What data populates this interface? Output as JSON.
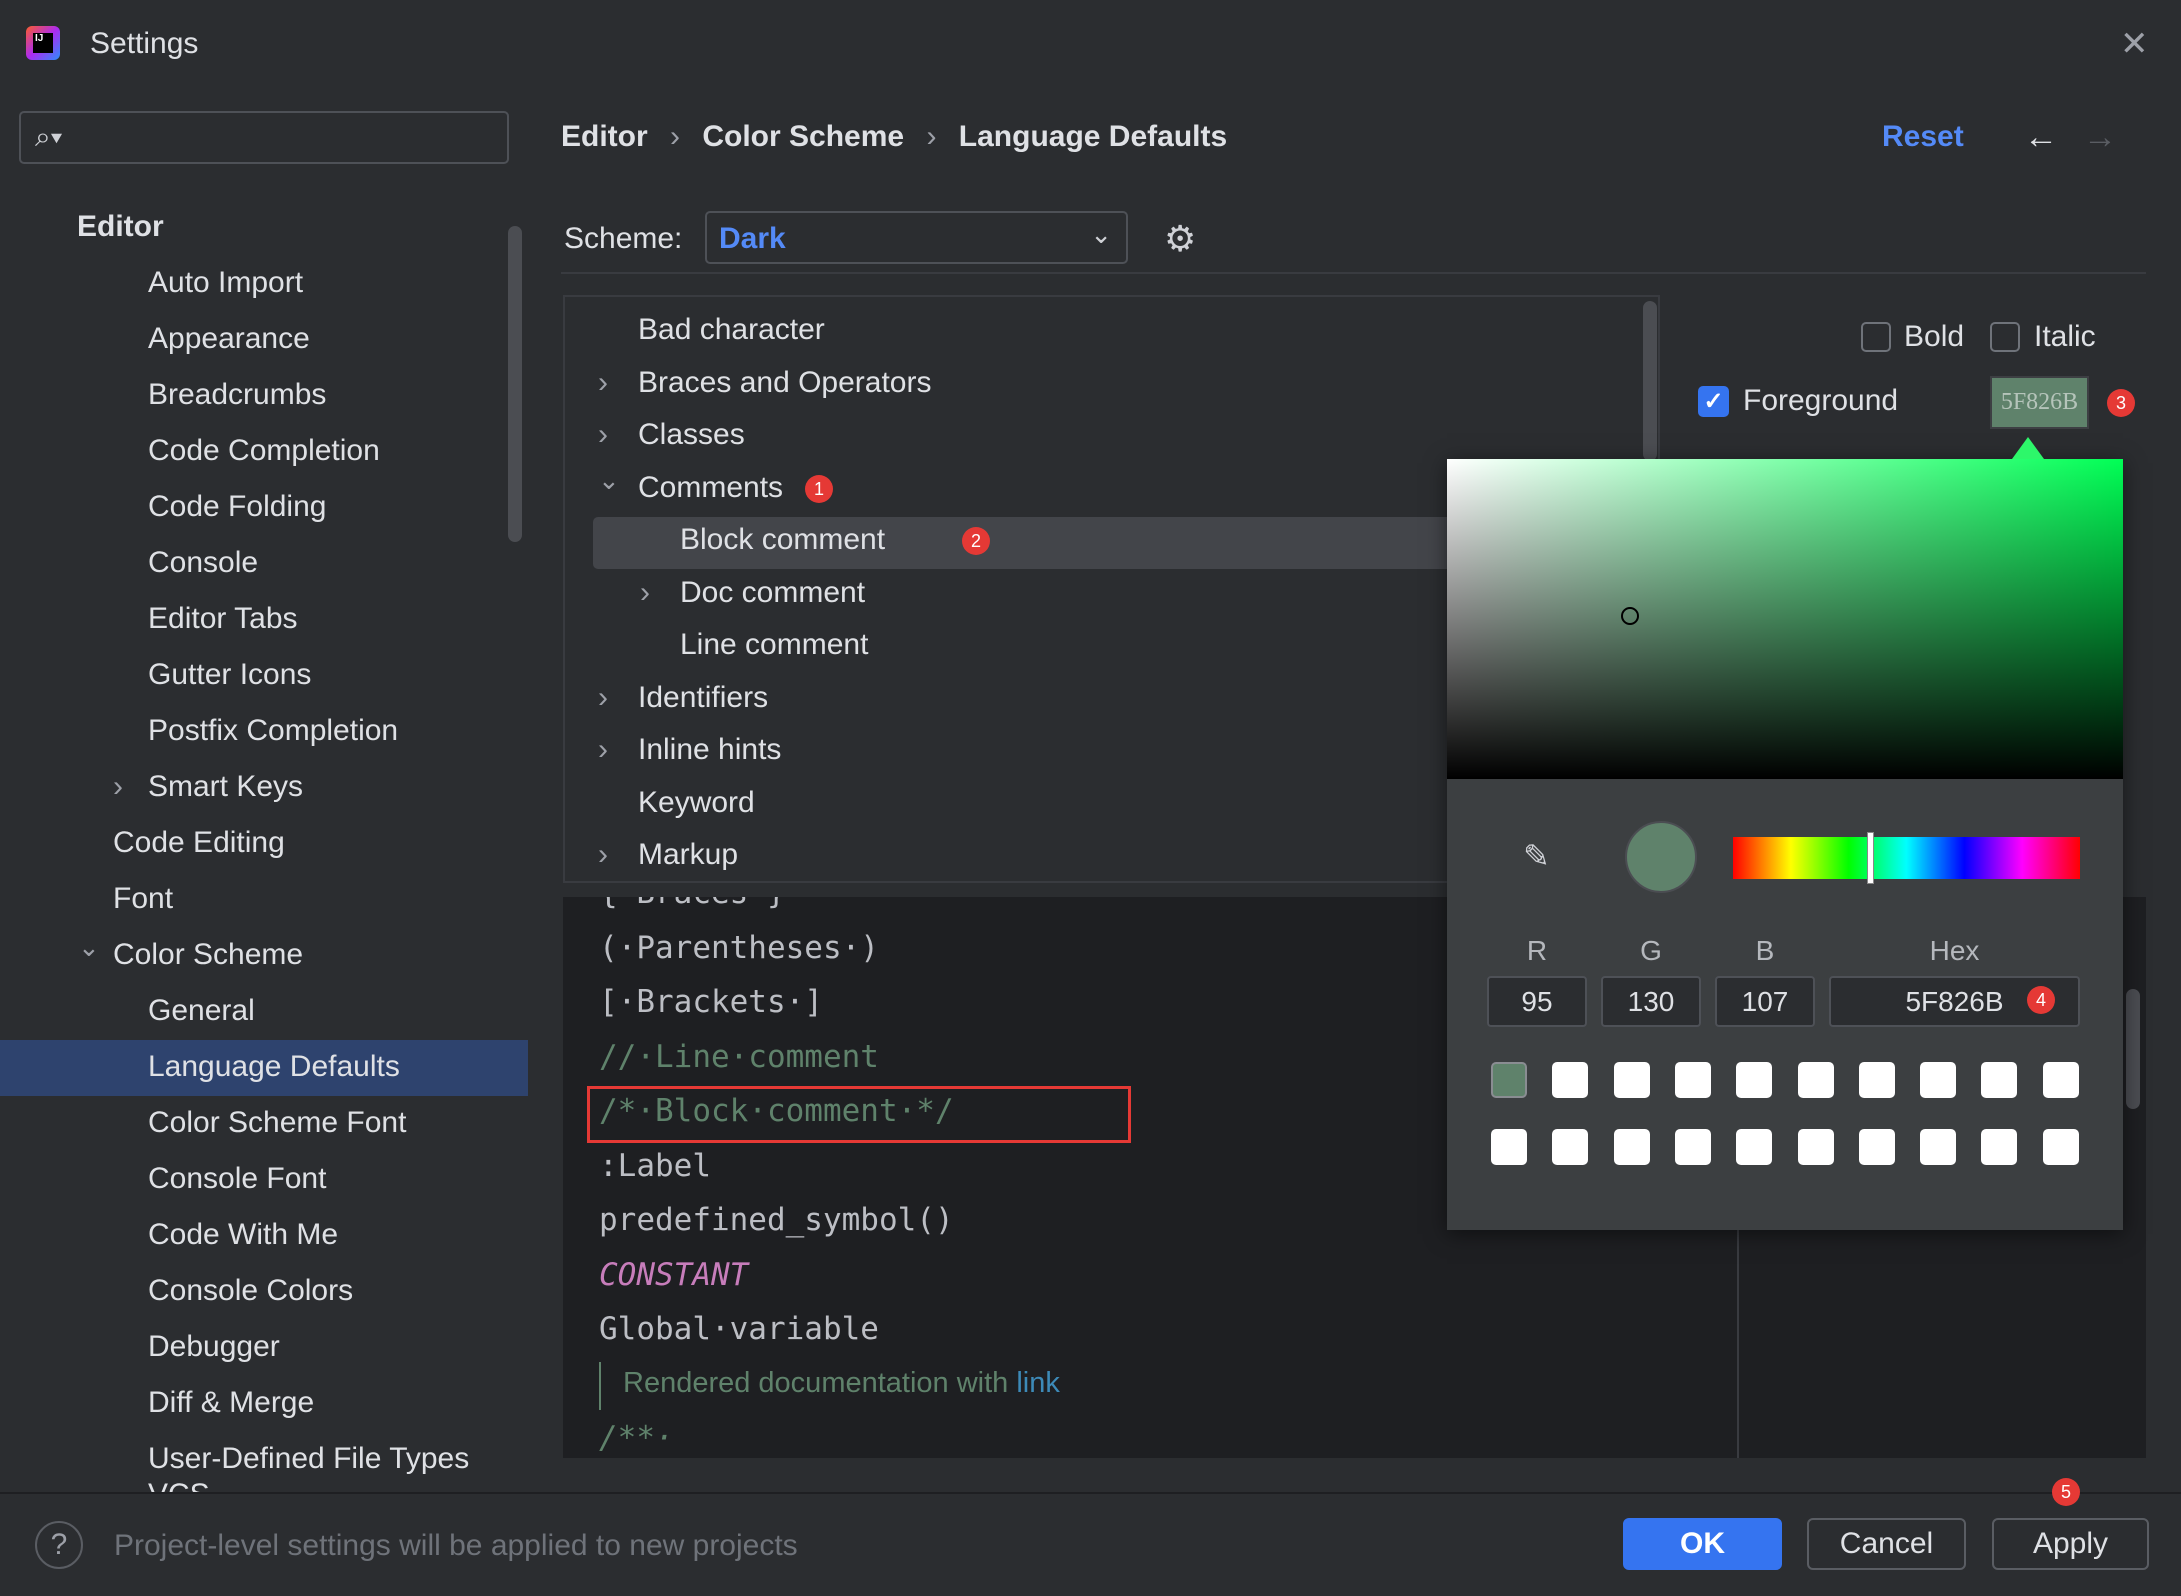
{
  "window": {
    "title": "Settings",
    "close_icon": "close-icon",
    "app_icon": "intellij-logo"
  },
  "search": {
    "placeholder": "",
    "icon": "search-icon"
  },
  "sidebar": {
    "items": [
      {
        "label": "Editor",
        "level": 0
      },
      {
        "label": "Auto Import",
        "level": 2
      },
      {
        "label": "Appearance",
        "level": 2
      },
      {
        "label": "Breadcrumbs",
        "level": 2
      },
      {
        "label": "Code Completion",
        "level": 2
      },
      {
        "label": "Code Folding",
        "level": 2
      },
      {
        "label": "Console",
        "level": 2
      },
      {
        "label": "Editor Tabs",
        "level": 2
      },
      {
        "label": "Gutter Icons",
        "level": 2
      },
      {
        "label": "Postfix Completion",
        "level": 2
      },
      {
        "label": "Smart Keys",
        "level": 2,
        "expandable": true
      },
      {
        "label": "Code Editing",
        "level": 1
      },
      {
        "label": "Font",
        "level": 1
      },
      {
        "label": "Color Scheme",
        "level": 1,
        "expanded": true
      },
      {
        "label": "General",
        "level": 2
      },
      {
        "label": "Language Defaults",
        "level": 2,
        "selected": true
      },
      {
        "label": "Color Scheme Font",
        "level": 2
      },
      {
        "label": "Console Font",
        "level": 2
      },
      {
        "label": "Code With Me",
        "level": 2
      },
      {
        "label": "Console Colors",
        "level": 2
      },
      {
        "label": "Debugger",
        "level": 2
      },
      {
        "label": "Diff & Merge",
        "level": 2
      },
      {
        "label": "User-Defined File Types",
        "level": 2
      }
    ]
  },
  "breadcrumb": [
    "Editor",
    "Color Scheme",
    "Language Defaults"
  ],
  "header": {
    "reset": "Reset"
  },
  "scheme": {
    "label": "Scheme:",
    "value": "Dark"
  },
  "tree": [
    {
      "label": "Bad character",
      "level": 0,
      "chevron": ""
    },
    {
      "label": "Braces and Operators",
      "level": 0,
      "chevron": "›"
    },
    {
      "label": "Classes",
      "level": 0,
      "chevron": "›"
    },
    {
      "label": "Comments",
      "level": 0,
      "chevron": "⌄",
      "badge": "1"
    },
    {
      "label": "Block comment",
      "level": 1,
      "chevron": "",
      "badge": "2",
      "selected": true
    },
    {
      "label": "Doc comment",
      "level": 1,
      "chevron": "›"
    },
    {
      "label": "Line comment",
      "level": 1,
      "chevron": ""
    },
    {
      "label": "Identifiers",
      "level": 0,
      "chevron": "›"
    },
    {
      "label": "Inline hints",
      "level": 0,
      "chevron": "›"
    },
    {
      "label": "Keyword",
      "level": 0,
      "chevron": ""
    },
    {
      "label": "Markup",
      "level": 0,
      "chevron": "›"
    }
  ],
  "preview": {
    "lines": [
      {
        "text": "{·Braces·}",
        "color": "#bcbec4"
      },
      {
        "text": "(·Parentheses·)",
        "color": "#bcbec4"
      },
      {
        "text": "[·Brackets·]",
        "color": "#bcbec4"
      },
      {
        "text": "//·Line·comment",
        "color": "#5f826b"
      },
      {
        "text": "/*·Block·comment·*/",
        "color": "#5f826b",
        "highlighted": true
      },
      {
        "text": ":Label",
        "color": "#bcbec4"
      },
      {
        "text": "predefined_symbol()",
        "color": "#bcbec4"
      },
      {
        "text": "CONSTANT",
        "color": "#c77dbb",
        "italic": true
      },
      {
        "text": "Global·variable",
        "color": "#bcbec4"
      }
    ],
    "doc_text": "Rendered documentation with ",
    "doc_link": "link",
    "doc_start": "/**·"
  },
  "options": {
    "bold": {
      "label": "Bold",
      "checked": false
    },
    "italic": {
      "label": "Italic",
      "checked": false
    },
    "foreground": {
      "label": "Foreground",
      "checked": true,
      "value": "5F826B",
      "badge": "3"
    }
  },
  "picker": {
    "r_label": "R",
    "g_label": "G",
    "b_label": "B",
    "hex_label": "Hex",
    "r": "95",
    "g": "130",
    "b": "107",
    "hex": "5F826B",
    "hex_badge": "4",
    "color": "#5f826b",
    "hue_fraction": 0.39,
    "hue_color": "#00ff55"
  },
  "footer": {
    "help_text": "Project-level settings will be applied to new projects",
    "ok": "OK",
    "cancel": "Cancel",
    "apply": "Apply",
    "apply_badge": "5"
  },
  "colors": {
    "accent": "#3574f0",
    "link": "#548af7",
    "selection": "#2e436e",
    "annotation": "#e53935"
  }
}
